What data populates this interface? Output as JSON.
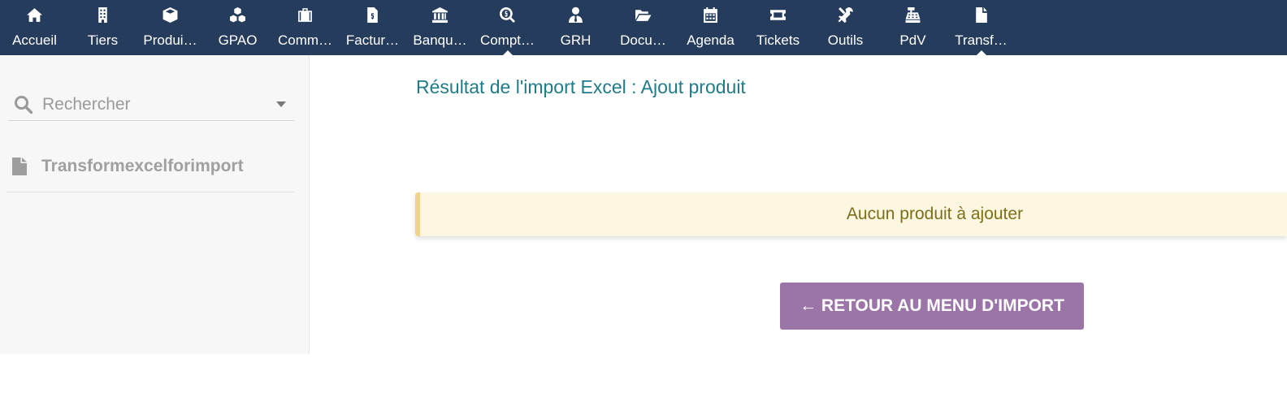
{
  "nav": {
    "items": [
      {
        "label": "Accueil",
        "icon": "home-icon"
      },
      {
        "label": "Tiers",
        "icon": "building-icon"
      },
      {
        "label": "Produi…",
        "icon": "box-icon"
      },
      {
        "label": "GPAO",
        "icon": "cubes-icon"
      },
      {
        "label": "Comm…",
        "icon": "suitcase-icon"
      },
      {
        "label": "Factur…",
        "icon": "invoice-icon"
      },
      {
        "label": "Banqu…",
        "icon": "bank-icon"
      },
      {
        "label": "Compt…",
        "icon": "search-dollar-icon"
      },
      {
        "label": "GRH",
        "icon": "user-tie-icon"
      },
      {
        "label": "Docu…",
        "icon": "folder-open-icon"
      },
      {
        "label": "Agenda",
        "icon": "calendar-icon"
      },
      {
        "label": "Tickets",
        "icon": "ticket-icon"
      },
      {
        "label": "Outils",
        "icon": "tools-icon"
      },
      {
        "label": "PdV",
        "icon": "cash-register-icon"
      },
      {
        "label": "Transf…",
        "icon": "file-icon"
      }
    ]
  },
  "sidebar": {
    "search_placeholder": "Rechercher",
    "entry_label": "Transformexcelforimport"
  },
  "main": {
    "title": "Résultat de l'import Excel : Ajout produit",
    "notice": "Aucun produit à ajouter",
    "back_button": "← RETOUR AU MENU D'IMPORT"
  },
  "colors": {
    "topbar": "#263c5c",
    "title": "#1f7b8a",
    "notice_bg": "#fdf6e0",
    "notice_border": "#f0d28a",
    "button": "#9b74a8"
  }
}
